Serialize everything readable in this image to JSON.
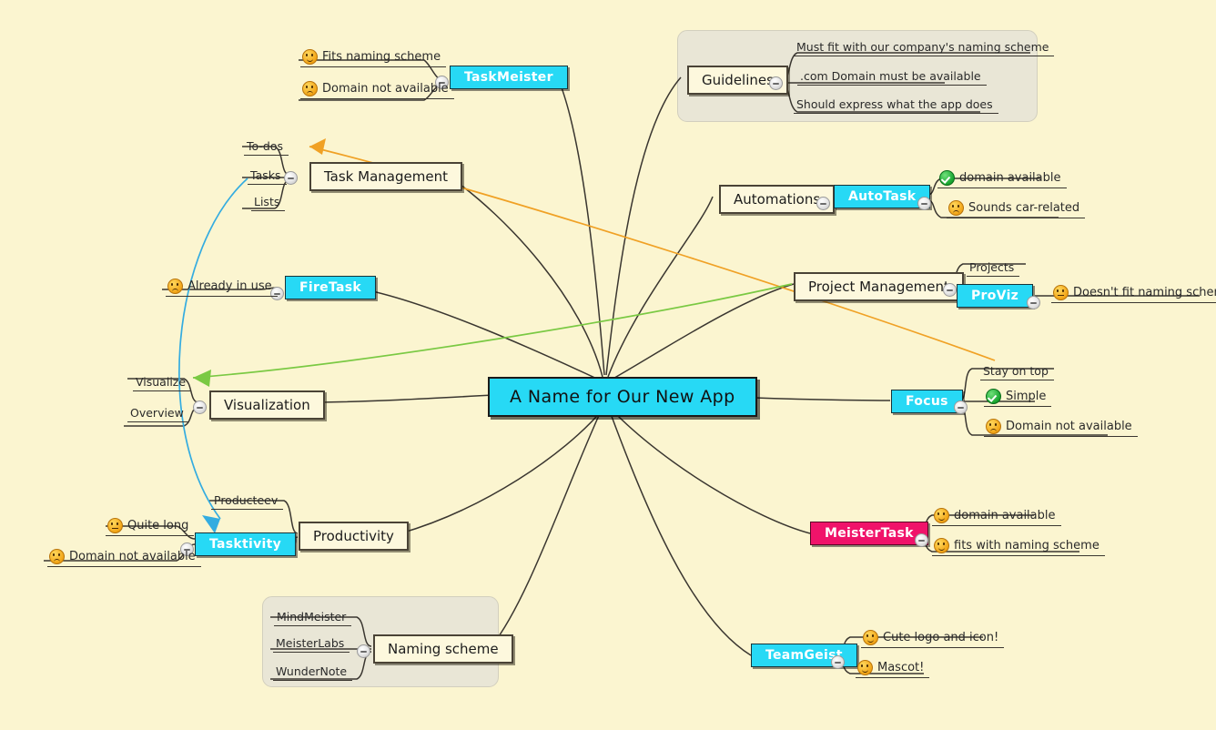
{
  "app": {
    "title": "A Name for Our New App",
    "canvas_background": "#fbf5d0",
    "root_color": "#27d9f5",
    "idea_color": "#27d9f5",
    "chosen_color": "#f0136a",
    "link_colors": {
      "orange": "#f0a125",
      "green": "#7ac943",
      "blue": "#34ace0"
    }
  },
  "root": {
    "label": "A Name for Our New App"
  },
  "branches": {
    "guidelines": {
      "label": "Guidelines",
      "items": [
        {
          "label": "Must fit with our company's naming scheme"
        },
        {
          "label": ".com Domain must be available"
        },
        {
          "label": "Should express what the app does"
        }
      ]
    },
    "task_management": {
      "label": "Task Management",
      "keywords": [
        {
          "label": "To-dos"
        },
        {
          "label": "Tasks"
        },
        {
          "label": "Lists"
        }
      ],
      "idea": {
        "label": "TaskMeister",
        "notes": [
          {
            "icon": "smiley-icon",
            "label": "Fits naming scheme"
          },
          {
            "icon": "sad-face-icon",
            "label": "Domain not available"
          }
        ]
      }
    },
    "automations": {
      "label": "Automations",
      "idea": {
        "label": "AutoTask",
        "notes": [
          {
            "icon": "green-check-icon",
            "label": "domain available"
          },
          {
            "icon": "sad-face-icon",
            "label": "Sounds car-related"
          }
        ]
      }
    },
    "project_management": {
      "label": "Project Management",
      "keywords": [
        {
          "label": "Projects"
        }
      ],
      "idea": {
        "label": "ProViz",
        "notes": [
          {
            "icon": "neutral-face-icon",
            "label": "Doesn't fit naming scheme"
          }
        ]
      }
    },
    "fire_task": {
      "idea": {
        "label": "FireTask",
        "notes": [
          {
            "icon": "sad-face-icon",
            "label": "Already in use"
          }
        ]
      }
    },
    "visualization": {
      "label": "Visualization",
      "keywords": [
        {
          "label": "Visualize"
        },
        {
          "label": "Overview"
        }
      ]
    },
    "focus": {
      "idea": {
        "label": "Focus",
        "notes": [
          {
            "icon": "none",
            "label": "Stay on top"
          },
          {
            "icon": "green-check-icon",
            "label": "Simple"
          },
          {
            "icon": "sad-face-icon",
            "label": "Domain not available"
          }
        ]
      }
    },
    "productivity": {
      "label": "Productivity",
      "keywords": [
        {
          "label": "Producteev"
        }
      ],
      "idea": {
        "label": "Tasktivity",
        "notes": [
          {
            "icon": "neutral-face-icon",
            "label": "Quite long"
          },
          {
            "icon": "sad-face-icon",
            "label": "Domain not available"
          }
        ]
      }
    },
    "meister_task": {
      "idea": {
        "label": "MeisterTask",
        "notes": [
          {
            "icon": "smiley-icon",
            "label": "domain available"
          },
          {
            "icon": "smiley-icon",
            "label": "fits with naming scheme"
          }
        ]
      }
    },
    "naming_scheme": {
      "label": "Naming scheme",
      "items": [
        {
          "label": "MindMeister"
        },
        {
          "label": "MeisterLabs"
        },
        {
          "label": "WunderNote"
        }
      ]
    },
    "team_geist": {
      "idea": {
        "label": "TeamGeist",
        "notes": [
          {
            "icon": "smiley-icon",
            "label": "Cute logo and icon!"
          },
          {
            "icon": "smiley-icon",
            "label": "Mascot!"
          }
        ]
      }
    }
  }
}
